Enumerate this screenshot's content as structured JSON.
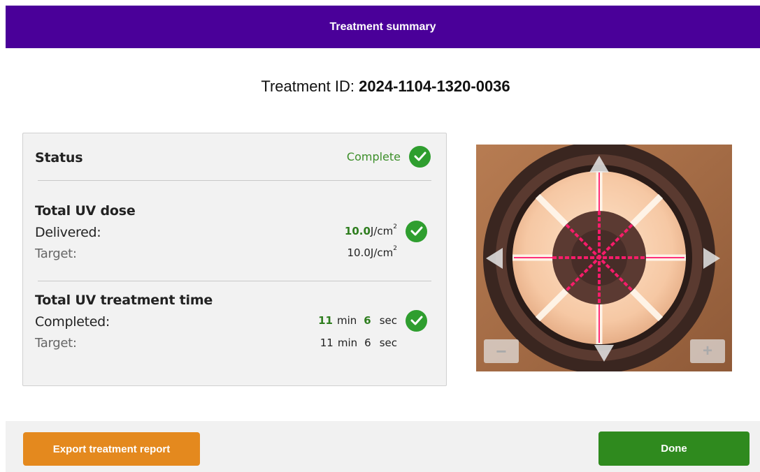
{
  "header": {
    "title": "Treatment summary",
    "color": "#4a0099"
  },
  "treatment": {
    "label": "Treatment ID: ",
    "id": "2024-1104-1320-0036"
  },
  "status": {
    "label": "Status",
    "value": "Complete",
    "icon": "check-circle-icon"
  },
  "dose": {
    "title": "Total UV dose",
    "delivered_label": "Delivered:",
    "delivered_value": "10.0",
    "delivered_unit": "J/cm",
    "unit_sup": "2",
    "target_label": "Target:",
    "target_value": "10.0",
    "target_unit": "J/cm",
    "icon": "check-circle-icon"
  },
  "time": {
    "title": "Total UV treatment time",
    "completed_label": "Completed:",
    "completed_min": "11",
    "completed_sec": "6",
    "min_label": "min",
    "sec_label": "sec",
    "target_label": "Target:",
    "target_min": "11",
    "target_sec": "6",
    "icon": "check-circle-icon"
  },
  "preview": {
    "zoom_out": "−",
    "zoom_in": "+",
    "icons": [
      "arrow-up-icon",
      "arrow-down-icon",
      "arrow-left-icon",
      "arrow-right-icon"
    ]
  },
  "footer": {
    "export_label": "Export treatment report",
    "done_label": "Done"
  },
  "colors": {
    "accent_green": "#2f9e2f",
    "export": "#e4891e",
    "done": "#2f8a1e"
  }
}
